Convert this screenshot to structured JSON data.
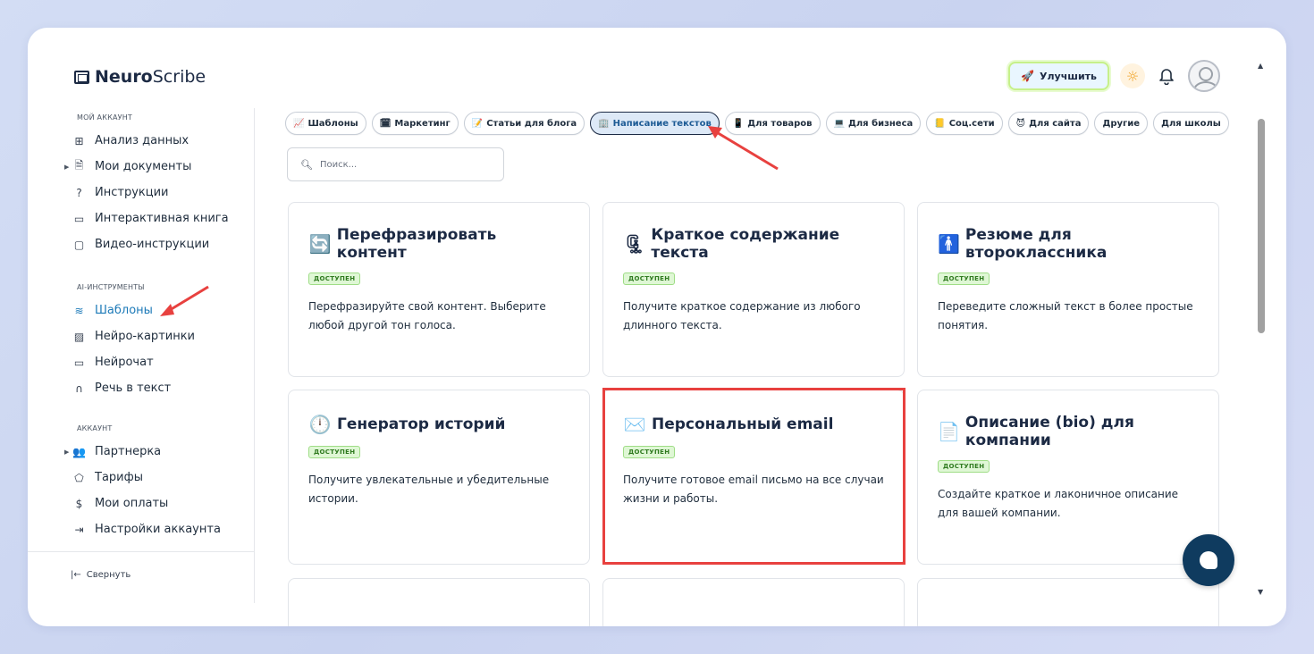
{
  "app": {
    "logo_bold": "Neuro",
    "logo_light": "Scribe"
  },
  "header": {
    "upgrade_label": "Улучшить"
  },
  "sidebar": {
    "sections": [
      {
        "title": "МОЙ АККАУНТ",
        "items": [
          {
            "label": "Анализ данных",
            "icon": "grid-icon"
          },
          {
            "label": "Мои документы",
            "icon": "document-icon",
            "expandable": true
          },
          {
            "label": "Инструкции",
            "icon": "help-circle-icon"
          },
          {
            "label": "Интерактивная книга",
            "icon": "book-icon"
          },
          {
            "label": "Видео-инструкции",
            "icon": "video-icon"
          }
        ]
      },
      {
        "title": "AI-ИНСТРУМЕНТЫ",
        "items": [
          {
            "label": "Шаблоны",
            "icon": "layers-icon",
            "active": true
          },
          {
            "label": "Нейро-картинки",
            "icon": "image-icon"
          },
          {
            "label": "Нейрочат",
            "icon": "chat-icon"
          },
          {
            "label": "Речь в текст",
            "icon": "headphones-icon"
          }
        ]
      },
      {
        "title": "АККАУНТ",
        "items": [
          {
            "label": "Партнерка",
            "icon": "users-icon",
            "expandable": true
          },
          {
            "label": "Тарифы",
            "icon": "tag-icon"
          },
          {
            "label": "Мои оплаты",
            "icon": "dollar-icon"
          },
          {
            "label": "Настройки аккаунта",
            "icon": "logout-icon"
          }
        ]
      }
    ],
    "collapse_label": "Свернуть"
  },
  "categories": [
    {
      "label": "Шаблоны",
      "icon": "📈"
    },
    {
      "label": "Маркетинг",
      "icon": "🗓"
    },
    {
      "label": "Статьи для блога",
      "icon": "📝"
    },
    {
      "label": "Написание текстов",
      "icon": "🏢",
      "active": true
    },
    {
      "label": "Для товаров",
      "icon": "📱"
    },
    {
      "label": "Для бизнеса",
      "icon": "💻"
    },
    {
      "label": "Соц.сети",
      "icon": "📒"
    },
    {
      "label": "Для сайта",
      "icon": "😈"
    },
    {
      "label": "Другие",
      "icon": ""
    },
    {
      "label": "Для школы",
      "icon": ""
    }
  ],
  "search": {
    "placeholder": "Поиск..."
  },
  "cards": [
    {
      "title": "Перефразировать контент",
      "icon": "🔄",
      "badge": "ДОСТУПЕН",
      "desc": "Перефразируйте свой контент. Выберите любой другой тон голоса."
    },
    {
      "title": "Краткое содержание текста",
      "icon": "🗜",
      "badge": "ДОСТУПЕН",
      "desc": "Получите краткое содержание из любого длинного текста."
    },
    {
      "title": "Резюме для второклассника",
      "icon": "🚹",
      "badge": "ДОСТУПЕН",
      "desc": "Переведите сложный текст в более простые понятия."
    },
    {
      "title": "Генератор историй",
      "icon": "🕛",
      "badge": "ДОСТУПЕН",
      "desc": "Получите увлекательные и убедительные истории."
    },
    {
      "title": "Персональный email",
      "icon": "✉️",
      "badge": "ДОСТУПЕН",
      "desc": "Получите готовое email письмо на все случаи жизни и работы."
    },
    {
      "title": "Описание (bio) для компании",
      "icon": "📄",
      "badge": "ДОСТУПЕН",
      "desc": "Создайте краткое и лаконичное описание для вашей компании."
    }
  ],
  "colors": {
    "accent": "#1d7ab8",
    "annotation_red": "#e8413f",
    "fab": "#0f3b5f"
  }
}
